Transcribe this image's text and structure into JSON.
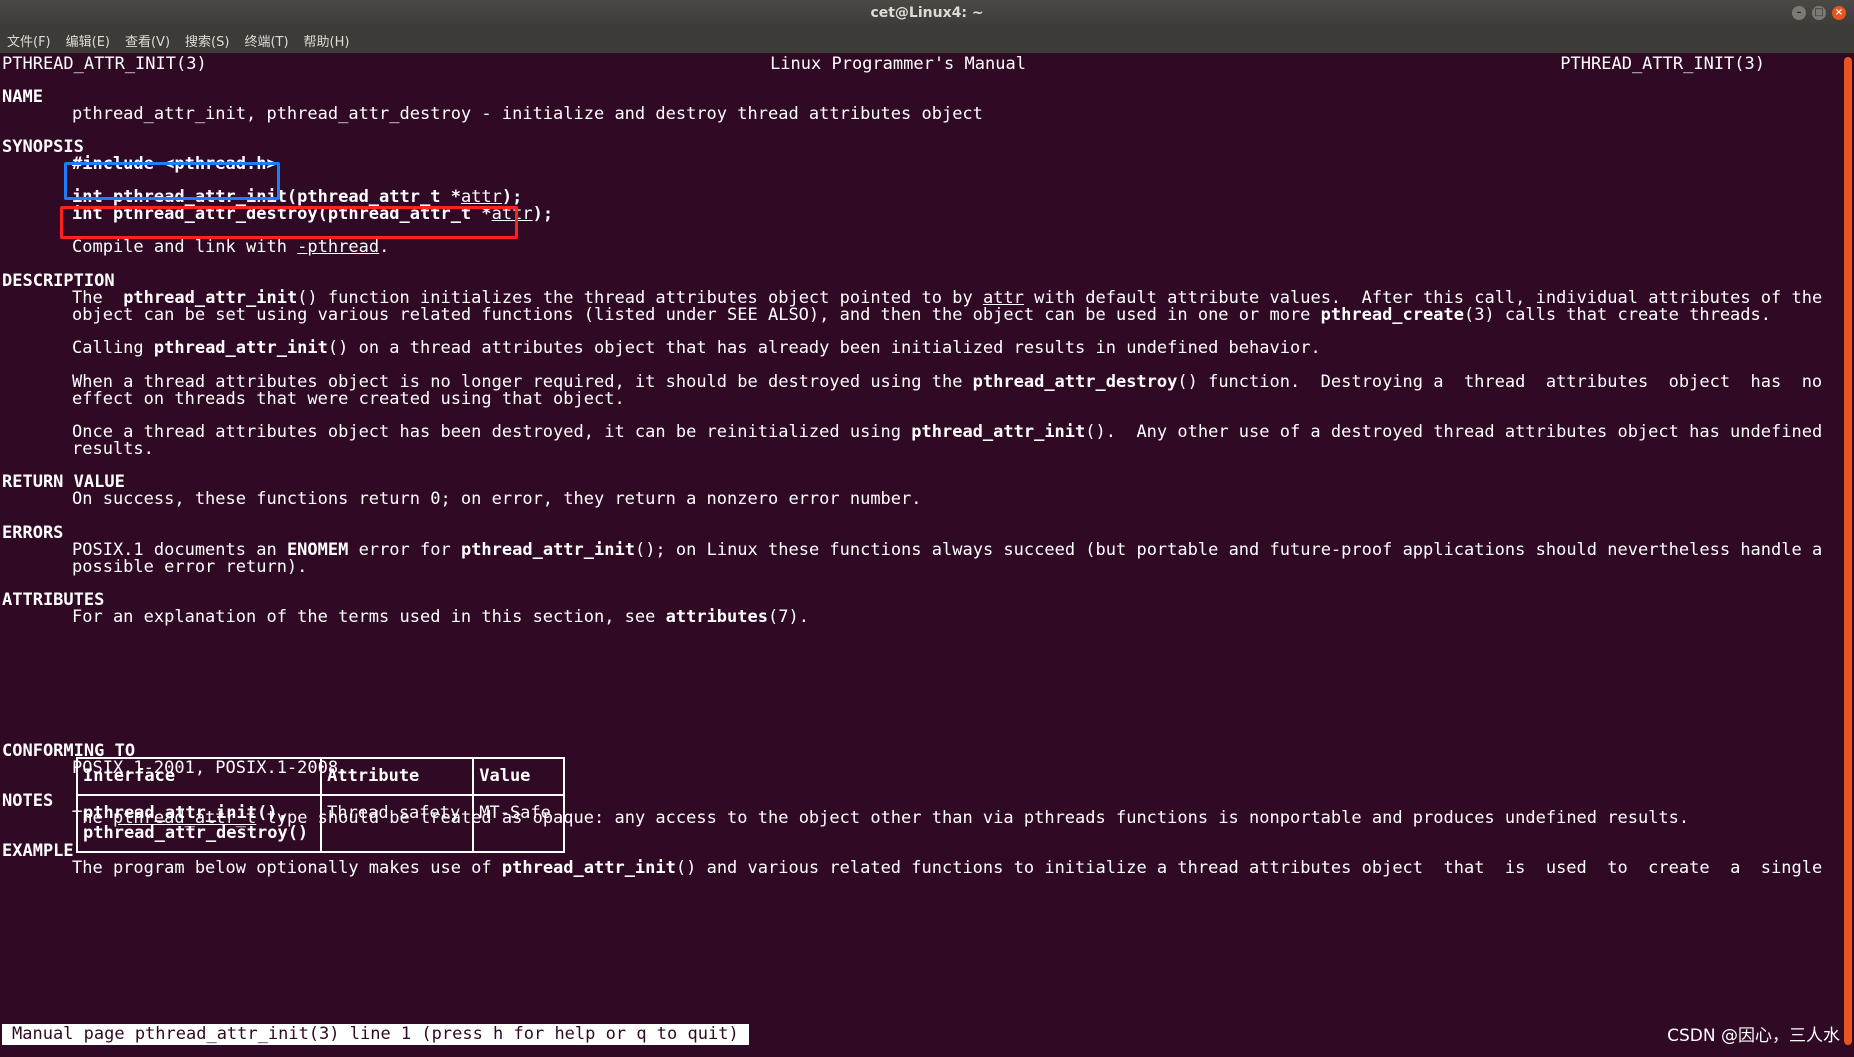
{
  "window": {
    "title": "cet@Linux4: ~",
    "controls": [
      "minimize-icon",
      "maximize-icon",
      "close-icon"
    ]
  },
  "menu": [
    "文件(F)",
    "编辑(E)",
    "查看(V)",
    "搜索(S)",
    "终端(T)",
    "帮助(H)"
  ],
  "header": {
    "left": "PTHREAD_ATTR_INIT(3)",
    "center": "Linux Programmer's Manual",
    "right": "PTHREAD_ATTR_INIT(3)"
  },
  "sections": {
    "name_h": "NAME",
    "name_text": "pthread_attr_init, pthread_attr_destroy - initialize and destroy thread attributes object",
    "synopsis_h": "SYNOPSIS",
    "include": "#include <pthread.h>",
    "proto1_a": "int pthread_attr_init(pthread_attr_t *",
    "proto1_arg": "attr",
    "proto1_b": ");",
    "proto2_a": "int pthread_attr_destroy(pthread_attr_t *",
    "proto2_arg": "attr",
    "proto2_b": ");",
    "compile_a": "Compile and link with ",
    "compile_flag": "-pthread",
    "compile_b": ".",
    "description_h": "DESCRIPTION",
    "d1_l1_a": "The  ",
    "d1_l1_fn": "pthread_attr_init",
    "d1_l1_b": "() function initializes the thread attributes object pointed to by ",
    "d1_l1_arg": "attr",
    "d1_l1_c": " with default attribute values.  After this call, individual attributes of the",
    "d1_l2_a": "object can be set using various related functions (listed under SEE ALSO), and then the object can be used in one or more ",
    "d1_l2_fn": "pthread_create",
    "d1_l2_b": "(3) calls that create threads.",
    "d2_a": "Calling ",
    "d2_fn": "pthread_attr_init",
    "d2_b": "() on a thread attributes object that has already been initialized results in undefined behavior.",
    "d3_l1_a": "When a thread attributes object is no longer required, it should be destroyed using the ",
    "d3_l1_fn": "pthread_attr_destroy",
    "d3_l1_b": "() function.  Destroying a  thread  attributes  object  has  no",
    "d3_l2": "effect on threads that were created using that object.",
    "d4_l1_a": "Once a thread attributes object has been destroyed, it can be reinitialized using ",
    "d4_l1_fn": "pthread_attr_init",
    "d4_l1_b": "().  Any other use of a destroyed thread attributes object has undefined",
    "d4_l2": "results.",
    "return_h": "RETURN VALUE",
    "return_text": "On success, these functions return 0; on error, they return a nonzero error number.",
    "errors_h": "ERRORS",
    "err_l1_a": "POSIX.1 documents an ",
    "err_l1_enomem": "ENOMEM",
    "err_l1_b": " error for ",
    "err_l1_fn": "pthread_attr_init",
    "err_l1_c": "(); on Linux these functions always succeed (but portable and future-proof applications should nevertheless handle a",
    "err_l2": "possible error return).",
    "attributes_h": "ATTRIBUTES",
    "attr_a": "For an explanation of the terms used in this section, see ",
    "attr_fn": "attributes",
    "attr_b": "(7).",
    "conforming_h": "CONFORMING TO",
    "conforming_text": "POSIX.1-2001, POSIX.1-2008.",
    "notes_h": "NOTES",
    "notes_a": "The ",
    "notes_type": "pthread_attr_t",
    "notes_b": " type should be treated as opaque: any access to the object other than via pthreads functions is nonportable and produces undefined results.",
    "example_h": "EXAMPLE",
    "ex_a": "The program below optionally makes use of ",
    "ex_fn": "pthread_attr_init",
    "ex_b": "() and various related functions to initialize a thread attributes object  that  is  used  to  create  a  single"
  },
  "attr_table": {
    "headers": [
      "Interface",
      "Attribute",
      "Value"
    ],
    "row_iface_1": "pthread_attr_init(),",
    "row_iface_2": "pthread_attr_destroy()",
    "row_attr": "Thread safety",
    "row_value": "MT-Safe"
  },
  "status_line": "Manual page pthread_attr_init(3) line 1 (press h for help or q to quit)",
  "watermark": "CSDN @因心，三人水",
  "colors": {
    "terminal_bg": "#300a24",
    "highlight_blue": "#1e7dff",
    "highlight_red": "#ff2020"
  }
}
